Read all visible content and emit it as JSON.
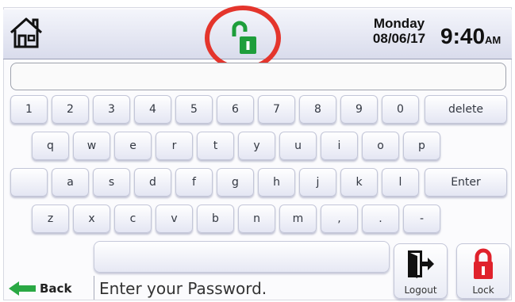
{
  "header": {
    "home_icon": "home-icon",
    "lock_status_icon": "unlocked-padlock-icon",
    "lock_status_color": "#1e9e3b",
    "highlight_color": "#e4352c",
    "day": "Monday",
    "date": "08/06/17",
    "time": "9:40",
    "ampm": "AM"
  },
  "password_field": {
    "value": ""
  },
  "keyboard": {
    "row1": [
      "1",
      "2",
      "3",
      "4",
      "5",
      "6",
      "7",
      "8",
      "9",
      "0"
    ],
    "delete_label": "delete",
    "row2": [
      "q",
      "w",
      "e",
      "r",
      "t",
      "y",
      "u",
      "i",
      "o",
      "p"
    ],
    "row3": [
      "a",
      "s",
      "d",
      "f",
      "g",
      "h",
      "j",
      "k",
      "l"
    ],
    "enter_label": "Enter",
    "row4": [
      "z",
      "x",
      "c",
      "v",
      "b",
      "n",
      "m",
      ",",
      ".",
      "-"
    ]
  },
  "footer": {
    "back_label": "Back",
    "back_icon": "left-arrow-icon",
    "back_icon_color": "#2aa844",
    "prompt": "Enter your Password.",
    "logout_label": "Logout",
    "logout_icon": "exit-door-icon",
    "lock_label": "Lock",
    "lock_icon": "locked-padlock-icon",
    "lock_icon_color": "#e0222c"
  }
}
